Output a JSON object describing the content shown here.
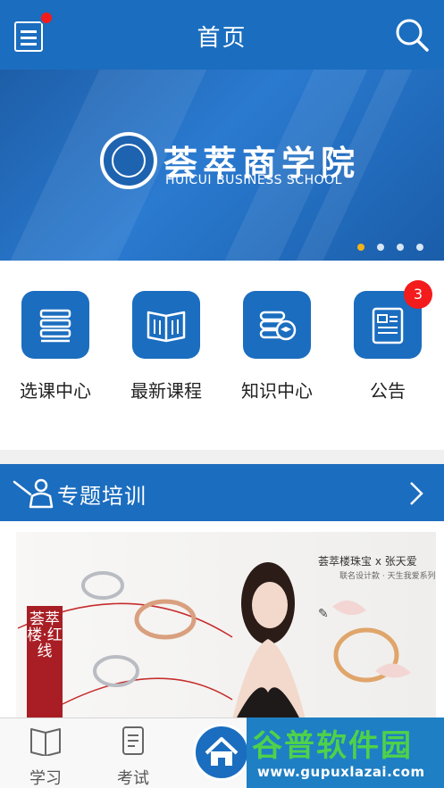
{
  "header": {
    "title": "首页"
  },
  "banner": {
    "name_cn": "荟萃商学院",
    "name_en": "HUICUI BUSINESS SCHOOL",
    "slide_count": 4,
    "active_slide": 1
  },
  "quick_nav": [
    {
      "label": "选课中心",
      "icon": "books-icon"
    },
    {
      "label": "最新课程",
      "icon": "open-book-icon"
    },
    {
      "label": "知识中心",
      "icon": "knowledge-icon"
    },
    {
      "label": "公告",
      "icon": "notice-icon",
      "badge": "3"
    }
  ],
  "section": {
    "title": "专题培训"
  },
  "ad": {
    "brand_line": "荟萃楼珠宝 x 张天爱",
    "sub_line": "联名设计款 · 天生我爱系列",
    "tag": "荟萃楼·红线"
  },
  "tabbar": [
    {
      "label": "学习",
      "icon": "book-icon"
    },
    {
      "label": "考试",
      "icon": "exam-icon"
    }
  ],
  "watermark": {
    "big": "谷普软件园",
    "url": "www.gupuxlazai.com"
  },
  "colors": {
    "primary": "#1b6dbf",
    "badge": "#f31b1b",
    "active_dot": "#f2b21a"
  }
}
